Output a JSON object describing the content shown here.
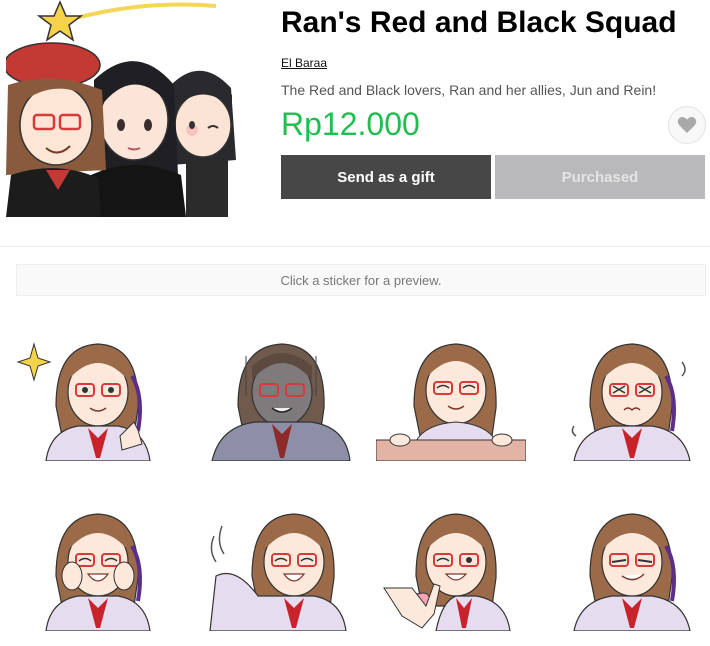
{
  "product": {
    "title": "Ran's Red and Black Squad",
    "author": "El Baraa",
    "description": "The Red and Black lovers, Ran and her allies, Jun and Rein!",
    "price": "Rp12.000"
  },
  "actions": {
    "gift_label": "Send as a gift",
    "purchased_label": "Purchased"
  },
  "icons": {
    "favorite": "heart-icon"
  },
  "preview_hint": "Click a sticker for a preview.",
  "colors": {
    "price": "#1fbe4e",
    "gift_button": "#474747",
    "purchased_button": "#b9b9bb"
  },
  "stickers": {
    "count": 8,
    "variants": [
      "sparkle-thumbs",
      "gloomy",
      "peeking-over-wall",
      "nervous",
      "happy-cheeks",
      "waving",
      "heart-hands",
      "smirk"
    ]
  }
}
